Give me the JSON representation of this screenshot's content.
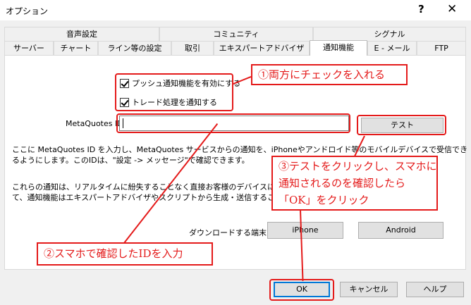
{
  "window": {
    "title": "オプション",
    "help_glyph": "?",
    "close_glyph": "✕"
  },
  "tabs": {
    "top": [
      "音声設定",
      "コミュニティ",
      "シグナル"
    ],
    "bottom": [
      "サーバー",
      "チャート",
      "ライン等の設定",
      "取引",
      "エキスパートアドバイザ",
      "通知機能",
      "E - メール",
      "FTP"
    ],
    "active": "通知機能"
  },
  "notifications": {
    "push_checkbox_label": "プッシュ通知機能を有効にする",
    "push_checked": true,
    "trade_checkbox_label": "トレード処理を通知する",
    "trade_checked": true,
    "metaquotes_id_label": "MetaQuotes ID",
    "metaquotes_id_value": "",
    "test_button": "テスト",
    "description_line1": "ここに MetaQuotes ID を入力し、MetaQuotes サービスからの通知を、iPhoneやアンドロイド等のモバイルデバイスで受信でき",
    "description_line2": "るようにします。このIDは、\"設定 -> メッセージ\"で確認できます。",
    "info_line1": "これらの通知は、リアルタイムに紛失することなく直接お客様のデバイスに送",
    "info_line2": "て、通知機能はエキスパートアドバイザやスクリプトから生成・送信すること",
    "download_label": "ダウンロードする端末:",
    "iphone_button": "iPhone",
    "android_button": "Android"
  },
  "footer": {
    "ok": "OK",
    "cancel": "キャンセル",
    "help": "ヘルプ"
  },
  "annotations": {
    "callout1": "①両方にチェックを入れる",
    "callout2": "②スマホで確認したIDを入力",
    "callout3_line1": "③テストをクリックし、スマホに",
    "callout3_line2": "通知されるのを確認したら",
    "callout3_line3": "「OK」をクリック",
    "color": "#e41a1a"
  }
}
